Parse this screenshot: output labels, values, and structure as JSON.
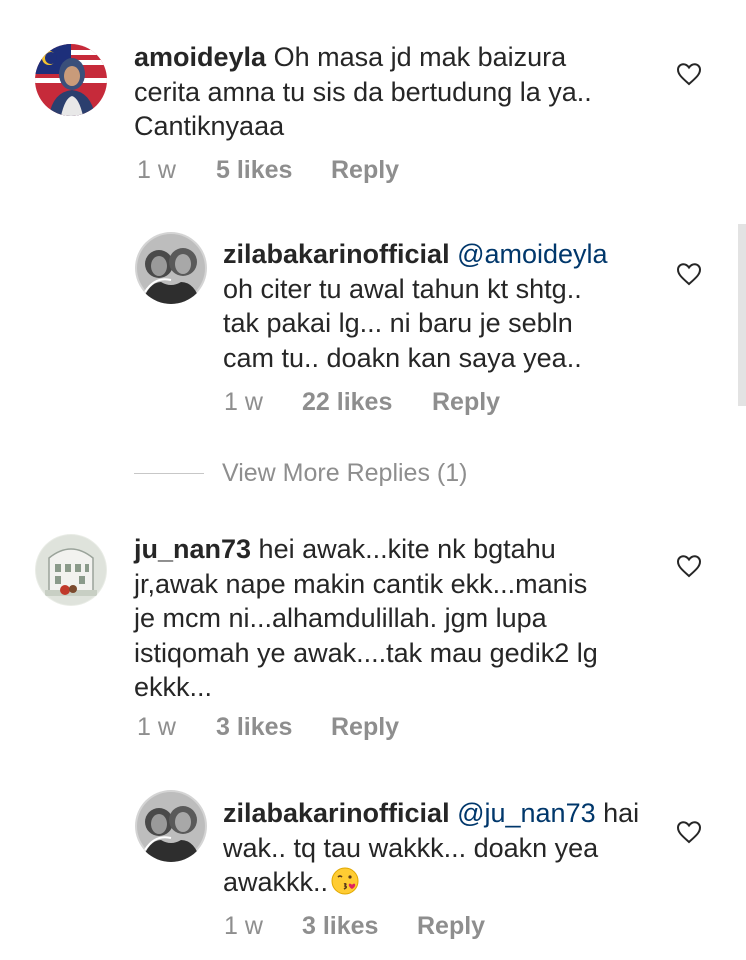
{
  "comments": [
    {
      "username": "amoideyla",
      "mention": "",
      "text": " Oh masa jd mak baizura\ncerita amna tu sis da bertudung la ya..\nCantiknyaaa",
      "time": "1 w",
      "likes": "5 likes",
      "reply": "Reply"
    },
    {
      "username": "zilabakarinofficial",
      "mention": " @amoideyla",
      "text": "\noh citer tu awal tahun kt shtg..\ntak pakai lg... ni baru je sebln\ncam tu.. doakn kan saya yea..",
      "time": "1 w",
      "likes": "22 likes",
      "reply": "Reply"
    },
    {
      "username": "ju_nan73",
      "mention": "",
      "text": " hei awak...kite nk bgtahu\njr,awak nape makin cantik ekk...manis\nje mcm ni...alhamdulillah. jgm lupa\nistiqomah ye awak....tak mau gedik2 lg\nekkk...",
      "time": "1 w",
      "likes": "3 likes",
      "reply": "Reply"
    },
    {
      "username": "zilabakarinofficial",
      "mention": " @ju_nan73",
      "text": " hai\nwak.. tq tau wakkk... doakn yea\nawakkk..",
      "time": "1 w",
      "likes": "3 likes",
      "reply": "Reply"
    }
  ],
  "view_more": "View More Replies (1)",
  "icons": {
    "like": "heart-outline-icon",
    "emoji": "kissing-face-emoji"
  },
  "colors": {
    "text": "#262626",
    "secondary": "#8e8e8e",
    "mention": "#00376b"
  }
}
